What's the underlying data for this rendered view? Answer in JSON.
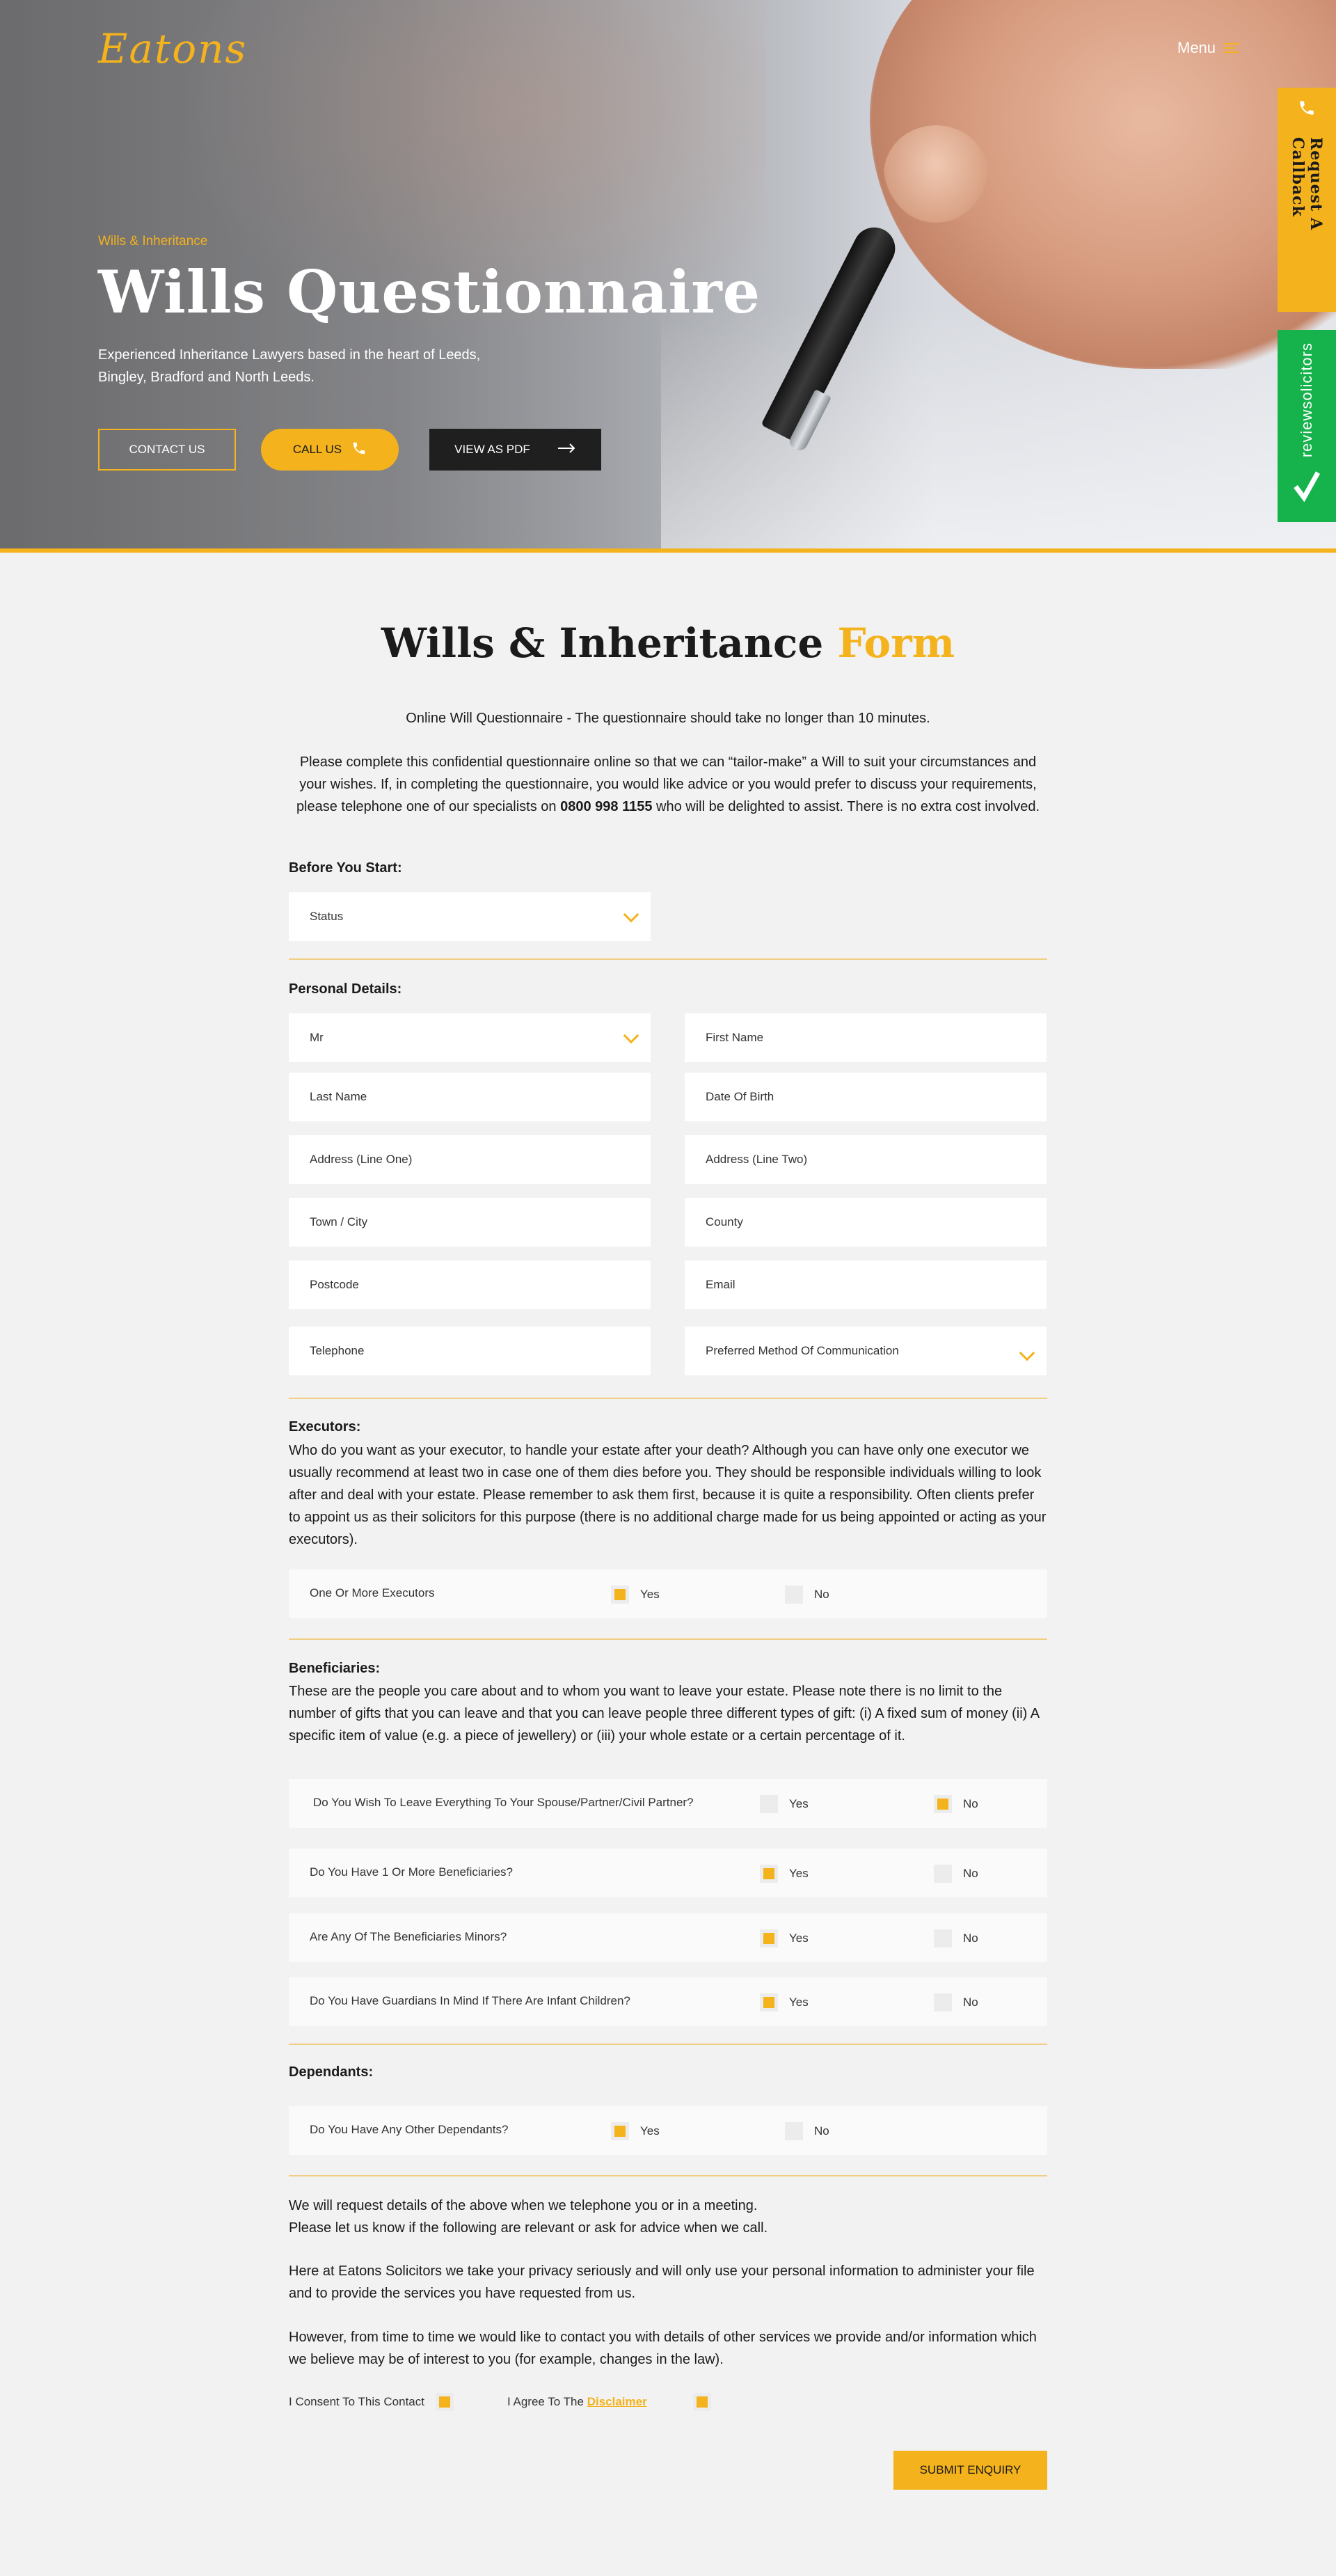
{
  "header": {
    "logo": "Eatons",
    "menu_label": "Menu"
  },
  "hero": {
    "eyebrow": "Wills & Inheritance",
    "title": "Wills Questionnaire",
    "subtitle": "Experienced Inheritance Lawyers based in the heart of Leeds, Bingley, Bradford and North Leeds.",
    "buttons": {
      "contact": "CONTACT US",
      "call": "CALL US",
      "pdf": "VIEW AS PDF"
    }
  },
  "side_tabs": {
    "callback": "Request A Callback",
    "review": "reviewsolicitors"
  },
  "form": {
    "title_main": "Wills & Inheritance",
    "title_highlight": "Form",
    "intro_line": "Online Will Questionnaire - The questionnaire should take no longer than 10 minutes.",
    "intro_para_a": "Please complete this confidential questionnaire online so that we can “tailor-make” a Will to suit your circumstances and your wishes. If, in completing the questionnaire, you would like advice or you would prefer to discuss your requirements, please telephone one of our specialists on ",
    "intro_phone": "0800 998 1155",
    "intro_para_b": " who will be delighted to assist. There is no extra cost involved.",
    "before_heading": "Before You Start:",
    "status_placeholder": "Status",
    "personal_heading": "Personal Details:",
    "fields": {
      "title": "Mr",
      "first_name": "First Name",
      "last_name": "Last Name",
      "dob": "Date Of Birth",
      "address1": "Address (Line One)",
      "address2": "Address (Line Two)",
      "town": "Town / City",
      "county": "County",
      "postcode": "Postcode",
      "email": "Email",
      "telephone": "Telephone",
      "communication": "Preferred Method Of Communication"
    },
    "executors_heading": "Executors:",
    "executors_text": "Who do you want as your executor, to handle your estate after your death? Although you can have only one executor we usually recommend at least two in case one of them dies before you. They should be responsible individuals willing to look after and deal with your estate. Please remember to ask them first, because it is quite a responsibility. Often clients prefer to appoint us as their solicitors for this purpose (there is no additional charge made for us being appointed or acting as your executors).",
    "beneficiaries_heading": "Beneficiaries:",
    "beneficiaries_text": "These are the people you care about and to whom you want to leave your estate. Please note there is no limit to the number of gifts that you can leave and that you can leave people three different types of gift: (i) A fixed sum of money (ii) A specific item of value (e.g. a piece of jewellery) or (iii) your whole estate or a certain percentage of it.",
    "dependants_heading": "Dependants:",
    "yes_label": "Yes",
    "no_label": "No",
    "questions": {
      "executors": "One Or More Executors",
      "spouse": "Do You Wish To Leave Everything To Your Spouse/Partner/Civil Partner?",
      "beneficiaries": "Do You Have 1 Or More Beneficiaries?",
      "minors": "Are Any Of The Beneficiaries Minors?",
      "guardians": "Do You Have Guardians In Mind If There Are Infant Children?",
      "dependants": "Do You Have Any Other Dependants?"
    },
    "closing_1": "We will request details of the above when we telephone you or in a meeting.",
    "closing_2": "Please let us know if the following are relevant or ask for advice when we call.",
    "privacy": "Here at Eatons Solicitors we take your privacy seriously and will only use your personal information to administer your file and to provide the services you have requested from us.",
    "contact_note": "However, from time to time we would like to contact you with details of other services we provide and/or information which we believe may be of interest to you (for example, changes in the law).",
    "consent_label": "I Consent To This Contact",
    "agree_label": "I Agree To The",
    "disclaimer_link": "Disclaimer",
    "submit": "SUBMIT ENQUIRY"
  },
  "colors": {
    "accent": "#f4b21c",
    "review_green": "#16b24b",
    "dark": "#1f1f1f"
  }
}
